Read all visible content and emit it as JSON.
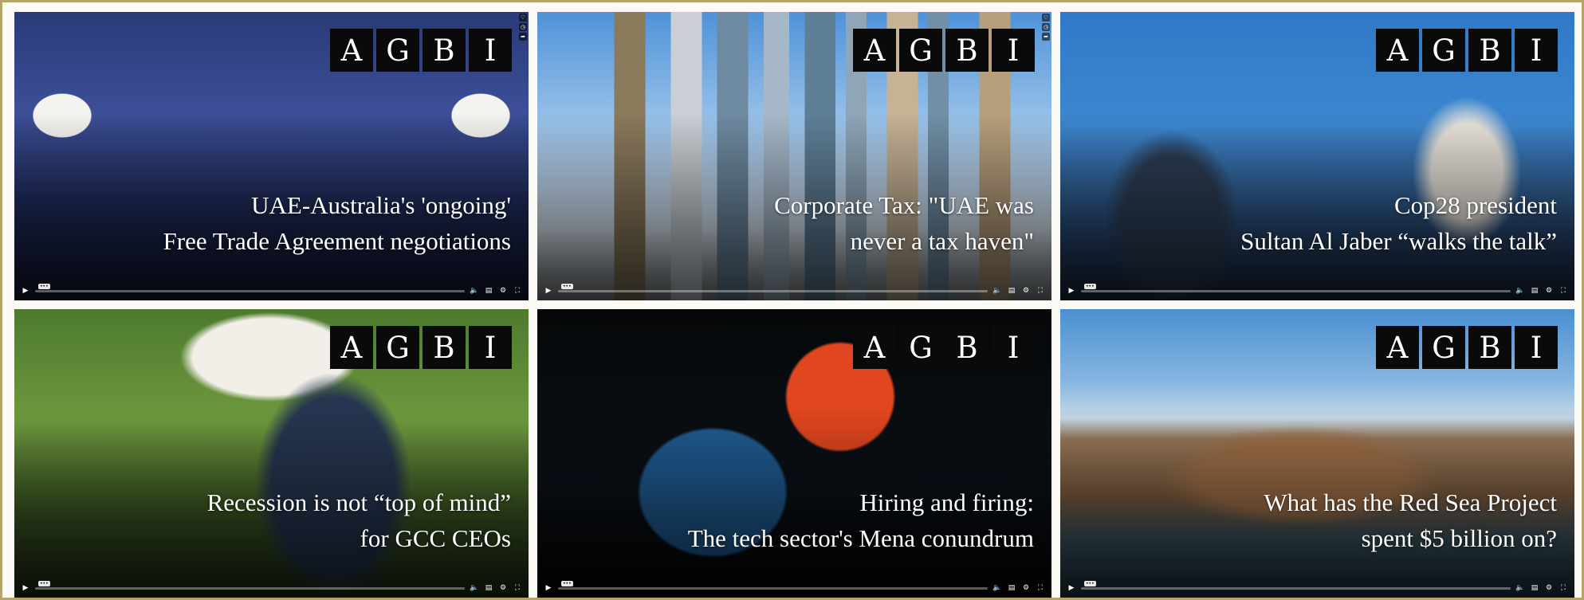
{
  "brand": {
    "logo_letters": [
      "A",
      "G",
      "B",
      "I"
    ],
    "frame_color": "#b3a46a"
  },
  "cards": [
    {
      "headline": [
        "UAE-Australia's 'ongoing'",
        "Free Trade Agreement negotiations"
      ],
      "progress": 0
    },
    {
      "headline": [
        "Corporate Tax: \"UAE was",
        "never a tax haven\""
      ],
      "progress": 0
    },
    {
      "headline": [
        "Cop28 president",
        "Sultan Al Jaber “walks the talk”"
      ],
      "progress": 0
    },
    {
      "headline": [
        "Recession is not “top of mind”",
        "for GCC CEOs"
      ],
      "progress": 0
    },
    {
      "headline": [
        "Hiring and firing:",
        "The tech sector's Mena conundrum"
      ],
      "progress": 0
    },
    {
      "headline": [
        "What has the Red Sea Project",
        "spent $5 billion on?"
      ],
      "progress": 0
    }
  ],
  "player_icons": {
    "play": "play-icon",
    "volume": "volume-icon",
    "captions": "captions-icon",
    "settings": "gear-icon",
    "fullscreen": "fullscreen-icon"
  }
}
